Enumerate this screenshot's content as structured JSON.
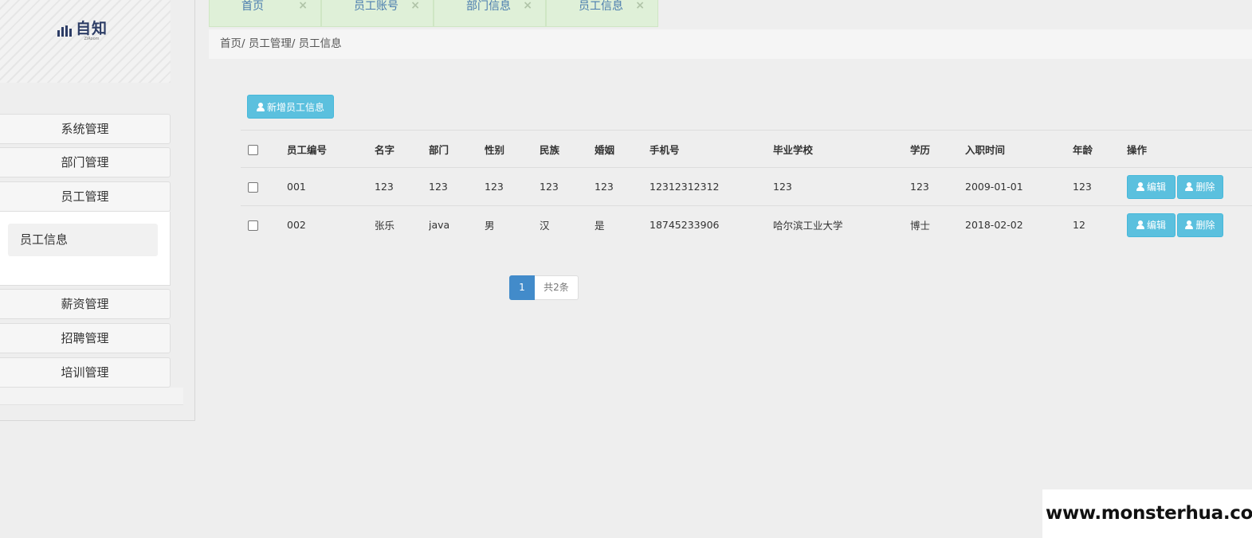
{
  "logo": {
    "text": "自知",
    "subtext": "ZiRoom"
  },
  "sidebar": {
    "groups": [
      {
        "label": "系统管理"
      },
      {
        "label": "部门管理"
      },
      {
        "label": "员工管理"
      },
      {
        "label": "薪资管理"
      },
      {
        "label": "招聘管理"
      },
      {
        "label": "培训管理"
      }
    ],
    "sub_item": {
      "label": "员工信息"
    }
  },
  "tabs": [
    {
      "label": "首页",
      "close": "×"
    },
    {
      "label": "员工账号",
      "close": "×"
    },
    {
      "label": "部门信息",
      "close": "×"
    },
    {
      "label": "员工信息",
      "close": "×"
    }
  ],
  "breadcrumb": {
    "text": "首页/ 员工管理/ 员工信息"
  },
  "toolbar": {
    "add_label": "新增员工信息"
  },
  "table": {
    "headers": [
      "员工编号",
      "名字",
      "部门",
      "性别",
      "民族",
      "婚姻",
      "手机号",
      "毕业学校",
      "学历",
      "入职时间",
      "年龄",
      "操作"
    ],
    "rows": [
      {
        "id": "001",
        "name": "123",
        "dept": "123",
        "gender": "123",
        "ethnicity": "123",
        "marital": "123",
        "phone": "12312312312",
        "school": "123",
        "education": "123",
        "hire_date": "2009-01-01",
        "age": "123"
      },
      {
        "id": "002",
        "name": "张乐",
        "dept": "java",
        "gender": "男",
        "ethnicity": "汉",
        "marital": "是",
        "phone": "18745233906",
        "school": "哈尔滨工业大学",
        "education": "博士",
        "hire_date": "2018-02-02",
        "age": "12"
      }
    ],
    "edit_label": "编辑",
    "delete_label": "删除"
  },
  "pagination": {
    "current": "1",
    "total": "共2条"
  },
  "watermark": "www.monsterhua.com",
  "colors": {
    "tab_bg": "#dff0d8",
    "tab_text": "#4a7cae",
    "button_info": "#5bc0de",
    "page_active": "#428bca",
    "logo": "#2d3d66"
  }
}
